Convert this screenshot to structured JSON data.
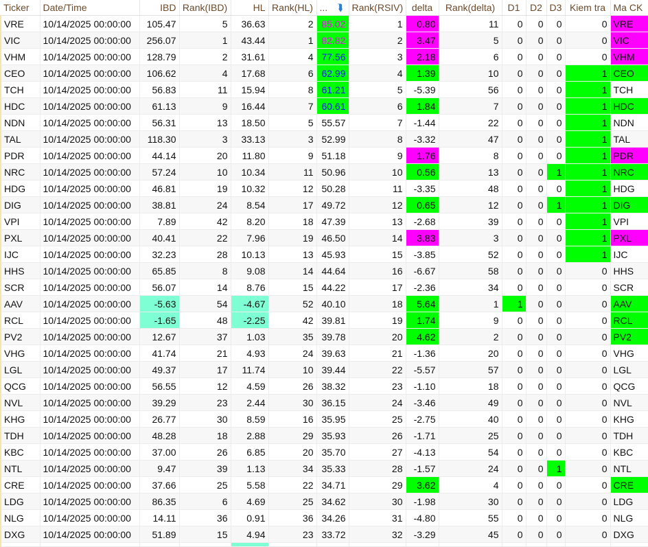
{
  "columns": [
    {
      "label": "Ticker",
      "align": "l"
    },
    {
      "label": "Date/Time",
      "align": "l"
    },
    {
      "label": "IBD",
      "align": "r"
    },
    {
      "label": "Rank(IBD)",
      "align": "c"
    },
    {
      "label": "HL",
      "align": "r"
    },
    {
      "label": "Rank(HL)",
      "align": "c"
    },
    {
      "label": "...",
      "align": "l",
      "icon": "sort-descending-icon"
    },
    {
      "label": "Rank(RSIV)",
      "align": "c"
    },
    {
      "label": "delta",
      "align": "c"
    },
    {
      "label": "Rank(delta)",
      "align": "c"
    },
    {
      "label": "D1",
      "align": "c"
    },
    {
      "label": "D2",
      "align": "c"
    },
    {
      "label": "D3",
      "align": "c"
    },
    {
      "label": "Kiem tra",
      "align": "c"
    },
    {
      "label": "Ma CK",
      "align": "l"
    }
  ],
  "colors": {
    "green": "#00ff00",
    "magenta": "#ff00ff",
    "aqua": "#7fffd4",
    "blue": "#1010ff",
    "header": "#6b4a2b"
  },
  "rows": [
    {
      "cells": [
        "VRE",
        "10/14/2025 00:00:00",
        "105.47",
        "5",
        "36.63",
        "2",
        "85.02",
        "1",
        "0.80",
        "11",
        "0",
        "0",
        "0",
        "0",
        "VRE"
      ],
      "hl": {
        "6": "green",
        "8": "magenta",
        "14": "magenta"
      },
      "txt": {
        "6": "magenta"
      }
    },
    {
      "cells": [
        "VIC",
        "10/14/2025 00:00:00",
        "256.07",
        "1",
        "43.44",
        "1",
        "82.82",
        "2",
        "3.47",
        "5",
        "0",
        "0",
        "0",
        "0",
        "VIC"
      ],
      "hl": {
        "6": "green",
        "8": "magenta",
        "14": "magenta"
      },
      "txt": {
        "6": "magenta"
      }
    },
    {
      "cells": [
        "VHM",
        "10/14/2025 00:00:00",
        "128.79",
        "2",
        "31.61",
        "4",
        "77.56",
        "3",
        "2.18",
        "6",
        "0",
        "0",
        "0",
        "0",
        "VHM"
      ],
      "hl": {
        "6": "green",
        "8": "magenta",
        "14": "magenta"
      },
      "txt": {
        "6": "blue"
      }
    },
    {
      "cells": [
        "CEO",
        "10/14/2025 00:00:00",
        "106.62",
        "4",
        "17.68",
        "6",
        "62.99",
        "4",
        "1.39",
        "10",
        "0",
        "0",
        "0",
        "1",
        "CEO"
      ],
      "hl": {
        "6": "green",
        "8": "green",
        "13": "green",
        "14": "green"
      },
      "txt": {
        "6": "blue"
      }
    },
    {
      "cells": [
        "TCH",
        "10/14/2025 00:00:00",
        "56.83",
        "11",
        "15.94",
        "8",
        "61.21",
        "5",
        "-5.39",
        "56",
        "0",
        "0",
        "0",
        "1",
        "TCH"
      ],
      "hl": {
        "6": "green",
        "13": "green"
      },
      "txt": {
        "6": "blue"
      }
    },
    {
      "cells": [
        "HDC",
        "10/14/2025 00:00:00",
        "61.13",
        "9",
        "16.44",
        "7",
        "60.61",
        "6",
        "1.84",
        "7",
        "0",
        "0",
        "0",
        "1",
        "HDC"
      ],
      "hl": {
        "6": "green",
        "8": "green",
        "13": "green",
        "14": "green"
      },
      "txt": {
        "6": "blue"
      }
    },
    {
      "cells": [
        "NDN",
        "10/14/2025 00:00:00",
        "56.31",
        "13",
        "18.50",
        "5",
        "55.57",
        "7",
        "-1.44",
        "22",
        "0",
        "0",
        "0",
        "1",
        "NDN"
      ],
      "hl": {
        "13": "green"
      }
    },
    {
      "cells": [
        "TAL",
        "10/14/2025 00:00:00",
        "118.30",
        "3",
        "33.13",
        "3",
        "52.99",
        "8",
        "-3.32",
        "47",
        "0",
        "0",
        "0",
        "1",
        "TAL"
      ],
      "hl": {
        "13": "green"
      }
    },
    {
      "cells": [
        "PDR",
        "10/14/2025 00:00:00",
        "44.14",
        "20",
        "11.80",
        "9",
        "51.18",
        "9",
        "1.76",
        "8",
        "0",
        "0",
        "0",
        "1",
        "PDR"
      ],
      "hl": {
        "8": "magenta",
        "13": "green",
        "14": "magenta"
      }
    },
    {
      "cells": [
        "NRC",
        "10/14/2025 00:00:00",
        "57.24",
        "10",
        "10.34",
        "11",
        "50.96",
        "10",
        "0.56",
        "13",
        "0",
        "0",
        "1",
        "1",
        "NRC"
      ],
      "hl": {
        "8": "green",
        "12": "green",
        "13": "green",
        "14": "green"
      }
    },
    {
      "cells": [
        "HDG",
        "10/14/2025 00:00:00",
        "46.81",
        "19",
        "10.32",
        "12",
        "50.28",
        "11",
        "-3.35",
        "48",
        "0",
        "0",
        "0",
        "1",
        "HDG"
      ],
      "hl": {
        "13": "green"
      }
    },
    {
      "cells": [
        "DIG",
        "10/14/2025 00:00:00",
        "38.81",
        "24",
        "8.54",
        "17",
        "49.72",
        "12",
        "0.65",
        "12",
        "0",
        "0",
        "1",
        "1",
        "DIG"
      ],
      "hl": {
        "8": "green",
        "12": "green",
        "13": "green",
        "14": "green"
      }
    },
    {
      "cells": [
        "VPI",
        "10/14/2025 00:00:00",
        "7.89",
        "42",
        "8.20",
        "18",
        "47.39",
        "13",
        "-2.68",
        "39",
        "0",
        "0",
        "0",
        "1",
        "VPI"
      ],
      "hl": {
        "13": "green"
      }
    },
    {
      "cells": [
        "PXL",
        "10/14/2025 00:00:00",
        "40.41",
        "22",
        "7.96",
        "19",
        "46.50",
        "14",
        "3.83",
        "3",
        "0",
        "0",
        "0",
        "1",
        "PXL"
      ],
      "hl": {
        "8": "magenta",
        "13": "green",
        "14": "magenta"
      }
    },
    {
      "cells": [
        "IJC",
        "10/14/2025 00:00:00",
        "32.23",
        "28",
        "10.13",
        "13",
        "45.93",
        "15",
        "-3.85",
        "52",
        "0",
        "0",
        "0",
        "1",
        "IJC"
      ],
      "hl": {
        "13": "green"
      }
    },
    {
      "cells": [
        "HHS",
        "10/14/2025 00:00:00",
        "65.85",
        "8",
        "9.08",
        "14",
        "44.64",
        "16",
        "-6.67",
        "58",
        "0",
        "0",
        "0",
        "0",
        "HHS"
      ],
      "hl": {}
    },
    {
      "cells": [
        "SCR",
        "10/14/2025 00:00:00",
        "56.07",
        "14",
        "8.76",
        "15",
        "44.22",
        "17",
        "-2.36",
        "34",
        "0",
        "0",
        "0",
        "0",
        "SCR"
      ],
      "hl": {}
    },
    {
      "cells": [
        "AAV",
        "10/14/2025 00:00:00",
        "-5.63",
        "54",
        "-4.67",
        "52",
        "40.10",
        "18",
        "5.64",
        "1",
        "1",
        "0",
        "0",
        "0",
        "AAV"
      ],
      "hl": {
        "2": "aqua",
        "4": "aqua",
        "8": "green",
        "10": "green",
        "14": "green"
      }
    },
    {
      "cells": [
        "RCL",
        "10/14/2025 00:00:00",
        "-1.65",
        "48",
        "-2.25",
        "42",
        "39.81",
        "19",
        "1.74",
        "9",
        "0",
        "0",
        "0",
        "0",
        "RCL"
      ],
      "hl": {
        "2": "aqua",
        "4": "aqua",
        "8": "green",
        "14": "green"
      }
    },
    {
      "cells": [
        "PV2",
        "10/14/2025 00:00:00",
        "12.67",
        "37",
        "1.03",
        "35",
        "39.78",
        "20",
        "4.62",
        "2",
        "0",
        "0",
        "0",
        "0",
        "PV2"
      ],
      "hl": {
        "8": "green",
        "14": "green"
      }
    },
    {
      "cells": [
        "VHG",
        "10/14/2025 00:00:00",
        "41.74",
        "21",
        "4.93",
        "24",
        "39.63",
        "21",
        "-1.36",
        "20",
        "0",
        "0",
        "0",
        "0",
        "VHG"
      ],
      "hl": {}
    },
    {
      "cells": [
        "LGL",
        "10/14/2025 00:00:00",
        "49.37",
        "17",
        "11.74",
        "10",
        "39.44",
        "22",
        "-5.57",
        "57",
        "0",
        "0",
        "0",
        "0",
        "LGL"
      ],
      "hl": {}
    },
    {
      "cells": [
        "QCG",
        "10/14/2025 00:00:00",
        "56.55",
        "12",
        "4.59",
        "26",
        "38.32",
        "23",
        "-1.10",
        "18",
        "0",
        "0",
        "0",
        "0",
        "QCG"
      ],
      "hl": {}
    },
    {
      "cells": [
        "NVL",
        "10/14/2025 00:00:00",
        "39.29",
        "23",
        "2.44",
        "30",
        "36.15",
        "24",
        "-3.46",
        "49",
        "0",
        "0",
        "0",
        "0",
        "NVL"
      ],
      "hl": {}
    },
    {
      "cells": [
        "KHG",
        "10/14/2025 00:00:00",
        "26.77",
        "30",
        "8.59",
        "16",
        "35.95",
        "25",
        "-2.75",
        "40",
        "0",
        "0",
        "0",
        "0",
        "KHG"
      ],
      "hl": {}
    },
    {
      "cells": [
        "TDH",
        "10/14/2025 00:00:00",
        "48.28",
        "18",
        "2.88",
        "29",
        "35.93",
        "26",
        "-1.71",
        "25",
        "0",
        "0",
        "0",
        "0",
        "TDH"
      ],
      "hl": {}
    },
    {
      "cells": [
        "KBC",
        "10/14/2025 00:00:00",
        "37.00",
        "26",
        "6.85",
        "20",
        "35.70",
        "27",
        "-4.13",
        "54",
        "0",
        "0",
        "0",
        "0",
        "KBC"
      ],
      "hl": {}
    },
    {
      "cells": [
        "NTL",
        "10/14/2025 00:00:00",
        "9.47",
        "39",
        "1.13",
        "34",
        "35.33",
        "28",
        "-1.57",
        "24",
        "0",
        "0",
        "1",
        "0",
        "NTL"
      ],
      "hl": {
        "12": "green"
      }
    },
    {
      "cells": [
        "CRE",
        "10/14/2025 00:00:00",
        "37.66",
        "25",
        "5.58",
        "22",
        "34.71",
        "29",
        "3.62",
        "4",
        "0",
        "0",
        "0",
        "0",
        "CRE"
      ],
      "hl": {
        "8": "green",
        "14": "green"
      }
    },
    {
      "cells": [
        "LDG",
        "10/14/2025 00:00:00",
        "86.35",
        "6",
        "4.69",
        "25",
        "34.62",
        "30",
        "-1.98",
        "30",
        "0",
        "0",
        "0",
        "0",
        "LDG"
      ],
      "hl": {}
    },
    {
      "cells": [
        "NLG",
        "10/14/2025 00:00:00",
        "14.11",
        "36",
        "0.91",
        "36",
        "34.26",
        "31",
        "-4.80",
        "55",
        "0",
        "0",
        "0",
        "0",
        "NLG"
      ],
      "hl": {}
    },
    {
      "cells": [
        "DXG",
        "10/14/2025 00:00:00",
        "51.89",
        "15",
        "4.94",
        "23",
        "33.72",
        "32",
        "-3.29",
        "45",
        "0",
        "0",
        "0",
        "0",
        "DXG"
      ],
      "hl": {}
    }
  ]
}
